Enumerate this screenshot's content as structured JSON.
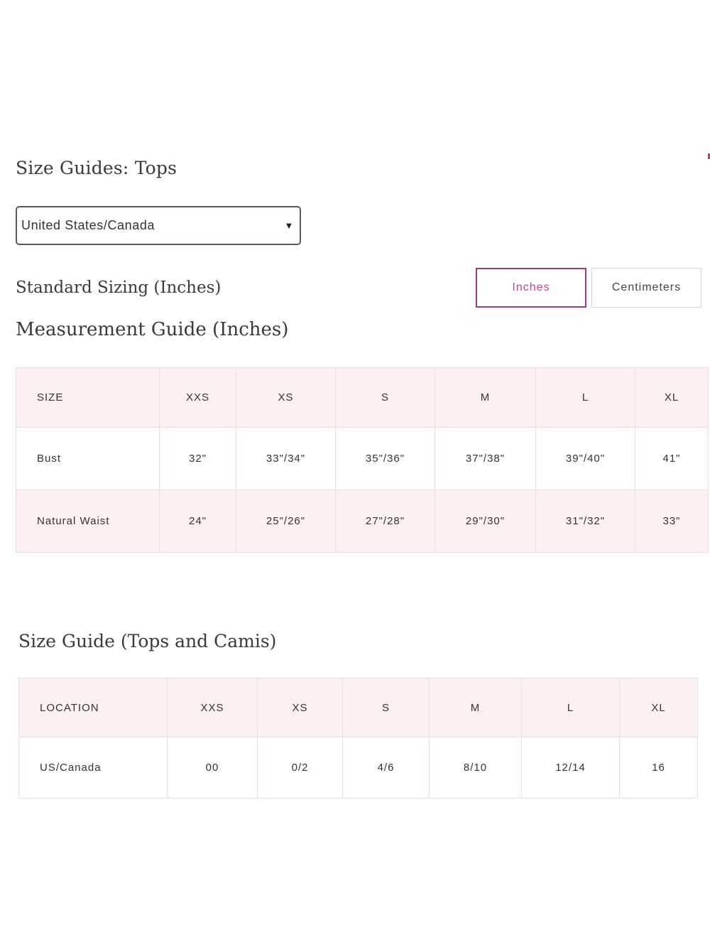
{
  "page": {
    "title": "Size Guides: Tops"
  },
  "region_select": {
    "value": "United States/Canada"
  },
  "standard_sizing": {
    "label": "Standard Sizing (Inches)",
    "units": [
      {
        "label": "Inches",
        "active": true
      },
      {
        "label": "Centimeters",
        "active": false
      }
    ]
  },
  "measurement_guide": {
    "title": "Measurement Guide (Inches)",
    "headers": [
      "SIZE",
      "XXS",
      "XS",
      "S",
      "M",
      "L",
      "XL"
    ],
    "rows": [
      [
        "Bust",
        "32\"",
        "33\"/34\"",
        "35\"/36\"",
        "37\"/38\"",
        "39\"/40\"",
        "41\""
      ],
      [
        "Natural Waist",
        "24\"",
        "25\"/26\"",
        "27\"/28\"",
        "29\"/30\"",
        "31\"/32\"",
        "33\""
      ]
    ]
  },
  "size_guide_camis": {
    "title": "Size Guide (Tops and Camis)",
    "headers": [
      "LOCATION",
      "XXS",
      "XS",
      "S",
      "M",
      "L",
      "XL"
    ],
    "rows": [
      [
        "US/Canada",
        "00",
        "0/2",
        "4/6",
        "8/10",
        "12/14",
        "16"
      ]
    ]
  },
  "colors": {
    "accent": "#c24598",
    "row_pink": "#fcf0f0",
    "border": "#ebdede"
  }
}
